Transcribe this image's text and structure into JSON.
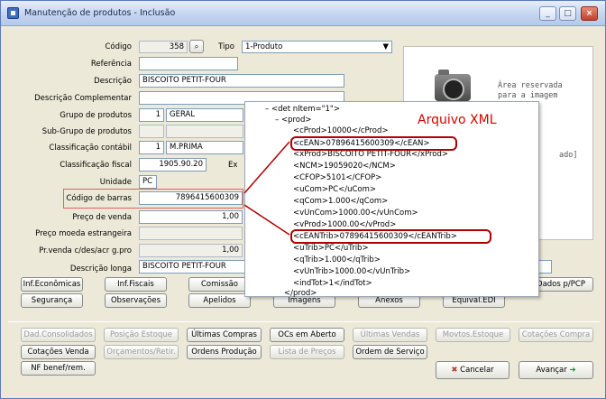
{
  "window": {
    "title": "Manutenção de produtos - Inclusão"
  },
  "form": {
    "codigo_label": "Código",
    "codigo_value": "358",
    "tipo_label": "Tipo",
    "tipo_value": "1-Produto",
    "referencia_label": "Referência",
    "descricao_label": "Descrição",
    "descricao_value": "BISCOITO PETIT-FOUR",
    "desc_compl_label": "Descrição Complementar",
    "grupo_label": "Grupo de produtos",
    "grupo_num": "1",
    "grupo_name": "GERAL",
    "subgrupo_label": "Sub-Grupo de produtos",
    "class_cont_label": "Classificação contábil",
    "class_cont_num": "1",
    "class_cont_name": "M.PRIMA",
    "class_fiscal_label": "Classificação fiscal",
    "class_fiscal_value": "1905.90.20",
    "class_fiscal_suffix": "Ex",
    "unidade_label": "Unidade",
    "unidade_value": "PC",
    "codigo_barras_label": "Código de barras",
    "codigo_barras_value": "7896415600309",
    "preco_venda_label": "Preço de venda",
    "preco_venda_value": "1,00",
    "preco_moeda_label": "Preço moeda estrangeira",
    "pr_venda_label": "Pr.venda c/des/acr g.pro",
    "pr_venda_value": "1,00",
    "desc_longa_label": "Descrição longa",
    "desc_longa_value": "BISCOITO PETIT-FOUR"
  },
  "image_area": {
    "line1": "Área reservada",
    "line2": "para a imagem",
    "line3": "ado]"
  },
  "xml": {
    "title": "Arquivo XML",
    "lines": [
      "–  <det nItem=\"1\">",
      "–  <prod>",
      "<cProd>10000</cProd>",
      "<cEAN>07896415600309</cEAN>",
      "<xProd>BISCOITO PETIT-FOUR</xProd>",
      "<NCM>19059020</NCM>",
      "<CFOP>5101</CFOP>",
      "<uCom>PC</uCom>",
      "<qCom>1.000</qCom>",
      "<vUnCom>1000.00</vUnCom>",
      "<vProd>1000.00</vProd>",
      "<cEANTrib>07896415600309</cEANTrib>",
      "<uTrib>PC</uTrib>",
      "<qTrib>1.000</qTrib>",
      "<vUnTrib>1000.00</vUnTrib>",
      "<indTot>1</indTot>",
      "</prod>"
    ]
  },
  "tabs_row1": [
    "Inf.Econômicas",
    "Inf.Fiscais",
    "Comissão",
    "Dados p/PCP"
  ],
  "tabs_row2": [
    "Segurança",
    "Observações",
    "Apelidos",
    "Imagens",
    "Anexos",
    "Equival.EDI"
  ],
  "actions": {
    "row1": [
      "Dad.Consolidados",
      "Posição Estoque",
      "Últimas Compras",
      "OCs em Aberto",
      "Últimas Vendas",
      "Movtos.Estoque",
      "Cotações Compra"
    ],
    "row2": [
      "Cotações Venda",
      "Orçamentos/Retir.",
      "Ordens Produção",
      "Lista de Preços",
      "Ordem de Serviço"
    ],
    "row3": [
      "NF benef/rem."
    ]
  },
  "footer": {
    "cancel": "Cancelar",
    "next": "Avançar"
  },
  "colors": {
    "highlight": "#b00000",
    "xml_title": "#d40000"
  }
}
